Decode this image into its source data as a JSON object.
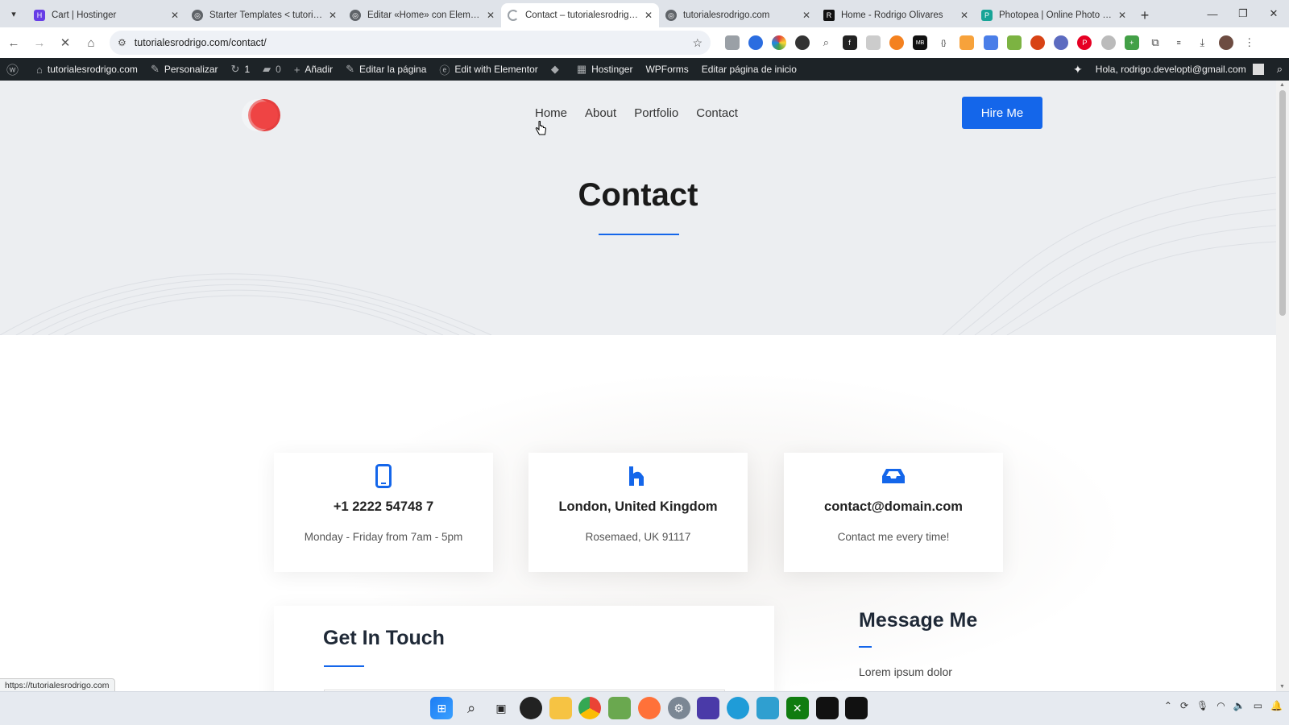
{
  "browser": {
    "tabs": [
      {
        "label": "Cart | Hostinger",
        "color": "#673de6",
        "active": false
      },
      {
        "label": "Starter Templates < tutorialesrodrigo",
        "color": "#5f6368",
        "active": false
      },
      {
        "label": "Editar «Home» con Elementor",
        "color": "#5f6368",
        "active": false
      },
      {
        "label": "Contact – tutorialesrodrigo.com",
        "color": "#9aa0a6",
        "active": true
      },
      {
        "label": "tutorialesrodrigo.com",
        "color": "#5f6368",
        "active": false
      },
      {
        "label": "Home - Rodrigo Olivares",
        "color": "#111111",
        "active": false
      },
      {
        "label": "Photopea | Online Photo Editor",
        "color": "#18a497",
        "active": false
      }
    ],
    "url": "tutorialesrodrigo.com/contact/",
    "status_url": "https://tutorialesrodrigo.com"
  },
  "wp_admin_bar": {
    "site": "tutorialesrodrigo.com",
    "customize": "Personalizar",
    "updates": "1",
    "comments": "0",
    "add_new": "Añadir",
    "edit_page": "Editar la página",
    "edit_elementor": "Edit with Elementor",
    "hostinger": "Hostinger",
    "wpforms": "WPForms",
    "edit_home": "Editar página de inicio",
    "greeting": "Hola, rodrigo.developti@gmail.com"
  },
  "site": {
    "nav": [
      "Home",
      "About",
      "Portfolio",
      "Contact"
    ],
    "hire_button": "Hire Me",
    "hero_title": "Contact",
    "brand_color": "#1466ea",
    "cards": [
      {
        "icon": "phone-icon",
        "title": "+1 2222 54748 7",
        "subtitle": "Monday - Friday from 7am - 5pm"
      },
      {
        "icon": "map-icon",
        "title": "London, United Kingdom",
        "subtitle": "Rosemaed, UK 91117"
      },
      {
        "icon": "inbox-icon",
        "title": "contact@domain.com",
        "subtitle": "Contact me every time!"
      }
    ],
    "form_title": "Get In Touch",
    "message_title": "Message Me",
    "message_body": "Lorem ipsum dolor"
  }
}
